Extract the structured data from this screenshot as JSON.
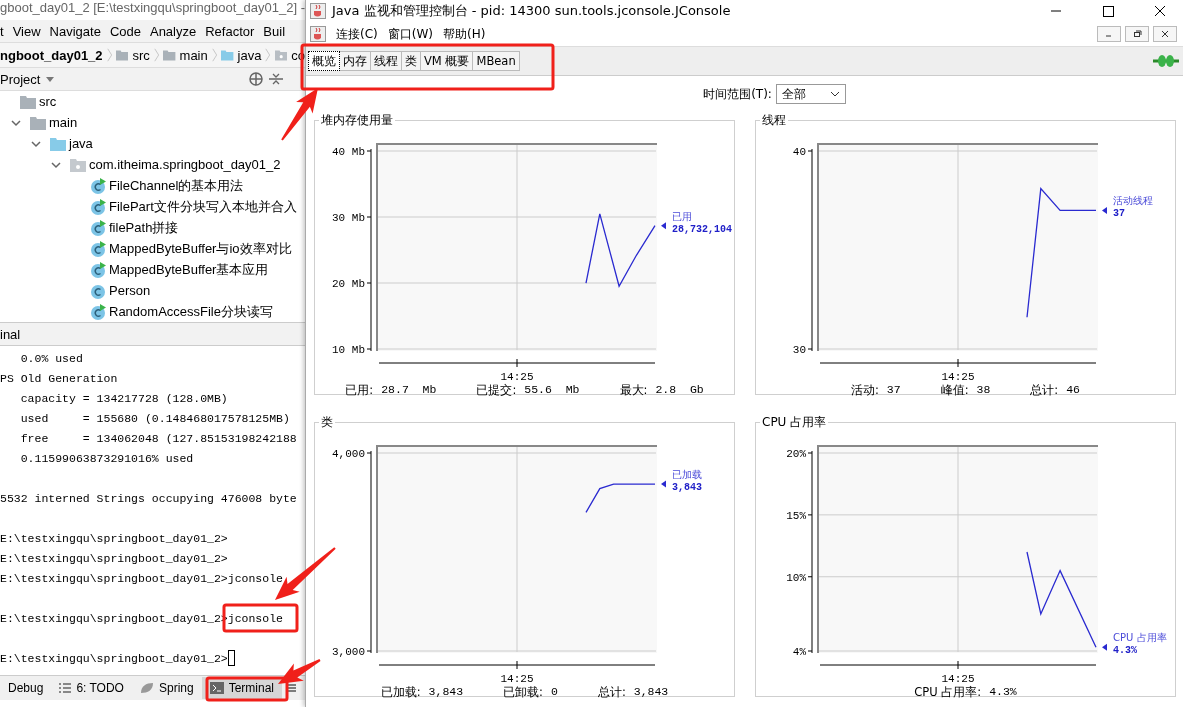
{
  "ide": {
    "title": "gboot_day01_2 [E:\\testxingqu\\springboot_day01_2] -",
    "menu": [
      "t",
      "View",
      "Navigate",
      "Code",
      "Analyze",
      "Refactor",
      "Buil"
    ],
    "breadcrumb": [
      {
        "label": "ngboot_day01_2",
        "kind": "project"
      },
      {
        "label": "src",
        "kind": "folder"
      },
      {
        "label": "main",
        "kind": "folder"
      },
      {
        "label": "java",
        "kind": "source"
      },
      {
        "label": "co",
        "kind": "package"
      }
    ],
    "project_view": {
      "title": "Project"
    },
    "tree": [
      {
        "label": "src",
        "kind": "folder",
        "children": [
          {
            "label": "main",
            "kind": "folder",
            "expanded": true,
            "children": [
              {
                "label": "java",
                "kind": "source",
                "expanded": true,
                "children": [
                  {
                    "label": "com.itheima.springboot_day01_2",
                    "kind": "package",
                    "expanded": true,
                    "children": [
                      {
                        "label": "FileChannel的基本用法",
                        "kind": "runnable"
                      },
                      {
                        "label": "FilePart文件分块写入本地并合入",
                        "kind": "runnable"
                      },
                      {
                        "label": "filePath拼接",
                        "kind": "runnable"
                      },
                      {
                        "label": "MappedByteBuffer与io效率对比",
                        "kind": "runnable"
                      },
                      {
                        "label": "MappedByteBuffer基本应用",
                        "kind": "runnable"
                      },
                      {
                        "label": "Person",
                        "kind": "class"
                      },
                      {
                        "label": "RandomAccessFile分块读写",
                        "kind": "runnable"
                      }
                    ]
                  }
                ]
              }
            ]
          }
        ]
      }
    ],
    "terminal": {
      "title": "inal",
      "blocks": [
        [
          "   0.0% used",
          "PS Old Generation",
          "   capacity = 134217728 (128.0MB)",
          "   used     = 155680 (0.148468017578125MB)",
          "   free     = 134062048 (127.85153198242188",
          "   0.11599063873291016% used"
        ],
        [
          "5532 interned Strings occupying 476008 byte"
        ],
        [
          "E:\\testxingqu\\springboot_day01_2>",
          "E:\\testxingqu\\springboot_day01_2>",
          "E:\\testxingqu\\springboot_day01_2>jconsole"
        ],
        [
          "E:\\testxingqu\\springboot_day01_2>jconsole"
        ],
        [
          "E:\\testxingqu\\springboot_day01_2>"
        ]
      ],
      "cursor": true
    },
    "tool_tabs": [
      {
        "label": "Debug",
        "kind": "debug",
        "selected": false
      },
      {
        "label": "6: TODO",
        "kind": "todo",
        "selected": false
      },
      {
        "label": "Spring",
        "kind": "spring",
        "selected": false
      },
      {
        "label": "Terminal",
        "kind": "terminal",
        "selected": true
      }
    ]
  },
  "jconsole": {
    "title": "Java 监视和管理控制台 - pid: 14300 sun.tools.jconsole.JConsole",
    "menu": [
      "连接(C)",
      "窗口(W)",
      "帮助(H)"
    ],
    "tabs": [
      {
        "label": "概览",
        "selected": true
      },
      {
        "label": "内存",
        "selected": false
      },
      {
        "label": "线程",
        "selected": false
      },
      {
        "label": "类",
        "selected": false
      },
      {
        "label": "VM 概要",
        "selected": false
      },
      {
        "label": "MBean",
        "selected": false
      }
    ],
    "time_range": {
      "label": "时间范围(T):",
      "value": "全部"
    },
    "panels": [
      {
        "title": "堆内存使用量",
        "y_axis_labels": [
          "40 Mb",
          "30 Mb",
          "20 Mb",
          "10 Mb"
        ],
        "x_axis_label": "14:25",
        "legend_name": "已用",
        "legend_value": "28,732,104",
        "stats": [
          {
            "label": "已用:",
            "value": "28.7  Mb"
          },
          {
            "label": "已提交:",
            "value": "55.6  Mb"
          },
          {
            "label": "最大:",
            "value": "2.8  Gb"
          }
        ]
      },
      {
        "title": "线程",
        "y_axis_labels": [
          "40",
          "30"
        ],
        "x_axis_label": "14:25",
        "legend_name": "活动线程",
        "legend_value": "37",
        "stats": [
          {
            "label": "活动:",
            "value": "37"
          },
          {
            "label": "峰值:",
            "value": "38"
          },
          {
            "label": "总计:",
            "value": "46"
          }
        ]
      },
      {
        "title": "类",
        "y_axis_labels": [
          "4,000",
          "3,000"
        ],
        "x_axis_label": "14:25",
        "legend_name": "已加载",
        "legend_value": "3,843",
        "stats": [
          {
            "label": "已加载:",
            "value": "3,843"
          },
          {
            "label": "已卸载:",
            "value": "0"
          },
          {
            "label": "总计:",
            "value": "3,843"
          }
        ]
      },
      {
        "title": "CPU 占用率",
        "y_axis_labels": [
          "20%",
          "15%",
          "10%",
          "4%"
        ],
        "x_axis_label": "14:25",
        "legend_name": "CPU 占用率",
        "legend_value": "4.3%",
        "stats": [
          {
            "label": "CPU 占用率:",
            "value": "4.3%"
          }
        ]
      }
    ]
  }
}
